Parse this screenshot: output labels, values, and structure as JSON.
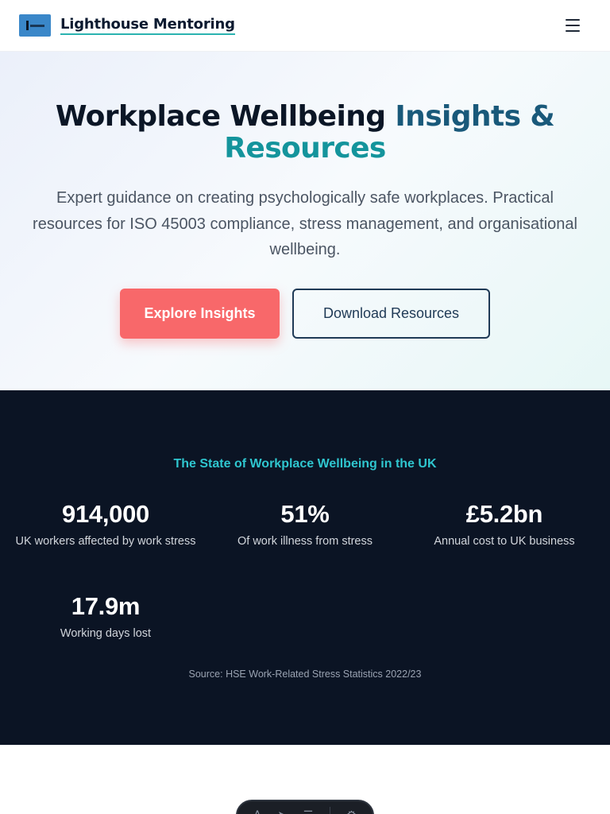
{
  "header": {
    "brand": "Lighthouse Mentoring",
    "logo_icon": "lighthouse-logo-icon",
    "menu_icon": "hamburger-menu-icon"
  },
  "hero": {
    "title_part1": "Workplace Wellbeing ",
    "title_part2": "Insights &",
    "title_part3": "Resources",
    "subtitle": "Expert guidance on creating psychologically safe workplaces. Practical resources for ISO 45003 compliance, stress management, and organisational wellbeing.",
    "primary_button": "Explore Insights",
    "secondary_button": "Download Resources"
  },
  "stats": {
    "heading": "The State of Workplace Wellbeing in the UK",
    "items": [
      {
        "value": "914,000",
        "label": "UK workers affected by work stress"
      },
      {
        "value": "51%",
        "label": "Of work illness from stress"
      },
      {
        "value": "£5.2bn",
        "label": "Annual cost to UK business"
      },
      {
        "value": "17.9m",
        "label": "Working days lost"
      }
    ],
    "source": "Source: HSE Work-Related Stress Statistics 2022/23"
  },
  "toolbar": {
    "icons": [
      "text-icon",
      "cursor-icon",
      "list-icon",
      "settings-icon"
    ]
  },
  "colors": {
    "accent_coral": "#f8686a",
    "navy": "#0b1424",
    "teal": "#2fc6cf",
    "title_blue": "#19597a",
    "title_teal": "#14949c"
  }
}
